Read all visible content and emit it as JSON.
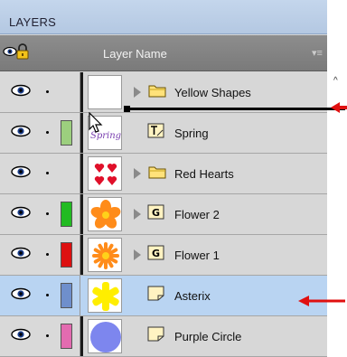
{
  "panel": {
    "title": "LAYERS",
    "header": {
      "eye_icon": "eye-icon",
      "lock_icon": "lock-icon",
      "name_column": "Layer Name",
      "menu_icon": "panel-menu-icon"
    }
  },
  "layers": [
    {
      "name": "Yellow Shapes",
      "kind": "folder",
      "expandable": true,
      "swatch": null,
      "thumb": "blank",
      "selected": false
    },
    {
      "name": "Spring",
      "kind": "text",
      "expandable": false,
      "swatch": "#9ccf7e",
      "thumb": "spring-text",
      "thumb_text": "Spring",
      "selected": false
    },
    {
      "name": "Red Hearts",
      "kind": "folder",
      "expandable": true,
      "swatch": null,
      "thumb": "hearts",
      "selected": false
    },
    {
      "name": "Flower 2",
      "kind": "group",
      "expandable": true,
      "swatch": "#22bb22",
      "thumb": "flower",
      "selected": false
    },
    {
      "name": "Flower 1",
      "kind": "group",
      "expandable": true,
      "swatch": "#dd1111",
      "thumb": "flower-star",
      "selected": false
    },
    {
      "name": "Asterix",
      "kind": "shape",
      "expandable": false,
      "swatch": "#6f8fcc",
      "thumb": "asterix",
      "selected": true
    },
    {
      "name": "Purple Circle",
      "kind": "shape",
      "expandable": false,
      "swatch": "#e36bb0",
      "thumb": "circle",
      "selected": false
    }
  ],
  "colors": {
    "selection": "#b9d4f2",
    "annotation_arrow": "#e01010"
  }
}
